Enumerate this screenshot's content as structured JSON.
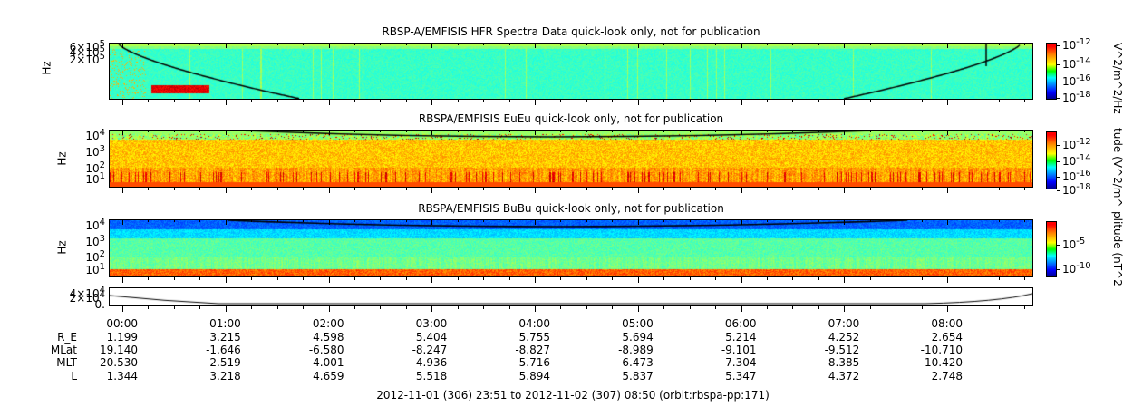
{
  "chart_data": {
    "type": "heatmap",
    "x_range": [
      "2012-11-01 23:51",
      "2012-11-02 08:50"
    ],
    "x_tick_labels": [
      "00:00",
      "01:00",
      "02:00",
      "03:00",
      "04:00",
      "05:00",
      "06:00",
      "07:00",
      "08:00"
    ],
    "panels": [
      {
        "title": "RBSP-A/EMFISIS  HFR Spectra Data quick-look only, not for publication",
        "ylabel": "Hz",
        "yticks": [
          {
            "base": "6×10",
            "exp": "5"
          },
          {
            "base": "4×10",
            "exp": "5"
          },
          {
            "base": "2×10",
            "exp": "5"
          }
        ],
        "colorbar_label": "V^2/m^2/Hz",
        "colorbar_ticks": [
          {
            "base": "10",
            "exp": "-12"
          },
          {
            "base": "10",
            "exp": "-14"
          },
          {
            "base": "10",
            "exp": "-16"
          },
          {
            "base": "10",
            "exp": "-18"
          }
        ]
      },
      {
        "title": "RBSPA/EMFISIS  EuEu quick-look only, not for publication",
        "ylabel": "Hz",
        "yticks": [
          {
            "base": "10",
            "exp": "4"
          },
          {
            "base": "10",
            "exp": "3"
          },
          {
            "base": "10",
            "exp": "2"
          },
          {
            "base": "10",
            "exp": "1"
          }
        ],
        "colorbar_label": "tude (V^2/m^",
        "colorbar_ticks": [
          {
            "base": "10",
            "exp": "-12"
          },
          {
            "base": "10",
            "exp": "-14"
          },
          {
            "base": "10",
            "exp": "-16"
          },
          {
            "base": "10",
            "exp": "-18"
          }
        ]
      },
      {
        "title": "RBSPA/EMFISIS  BuBu quick-look only, not for publication",
        "ylabel": "Hz",
        "yticks": [
          {
            "base": "10",
            "exp": "4"
          },
          {
            "base": "10",
            "exp": "3"
          },
          {
            "base": "10",
            "exp": "2"
          },
          {
            "base": "10",
            "exp": "1"
          }
        ],
        "colorbar_label": "plitude (nT^2",
        "colorbar_ticks": [
          {
            "base": "10",
            "exp": "-5"
          },
          {
            "base": "10",
            "exp": "-10"
          }
        ]
      },
      {
        "title": "",
        "yticks": [
          {
            "base": "4×10",
            "exp": "4"
          },
          {
            "base": "2×10",
            "exp": "4"
          },
          {
            "base": "0.",
            "exp": ""
          }
        ]
      }
    ]
  },
  "ephemeris": {
    "row_labels": [
      "R_E",
      "MLat",
      "MLT",
      "L"
    ],
    "columns": [
      {
        "time": "00:00",
        "RE": "1.199",
        "MLat": "19.140",
        "MLT": "20.530",
        "L": "1.344"
      },
      {
        "time": "01:00",
        "RE": "3.215",
        "MLat": "-1.646",
        "MLT": "2.519",
        "L": "3.218"
      },
      {
        "time": "02:00",
        "RE": "4.598",
        "MLat": "-6.580",
        "MLT": "4.001",
        "L": "4.659"
      },
      {
        "time": "03:00",
        "RE": "5.404",
        "MLat": "-8.247",
        "MLT": "4.936",
        "L": "5.518"
      },
      {
        "time": "04:00",
        "RE": "5.755",
        "MLat": "-8.827",
        "MLT": "5.716",
        "L": "5.894"
      },
      {
        "time": "05:00",
        "RE": "5.694",
        "MLat": "-8.989",
        "MLT": "6.473",
        "L": "5.837"
      },
      {
        "time": "06:00",
        "RE": "5.214",
        "MLat": "-9.101",
        "MLT": "7.304",
        "L": "5.347"
      },
      {
        "time": "07:00",
        "RE": "4.252",
        "MLat": "-9.512",
        "MLT": "8.385",
        "L": "4.372"
      },
      {
        "time": "08:00",
        "RE": "2.654",
        "MLat": "-10.710",
        "MLT": "10.420",
        "L": "2.748"
      }
    ]
  },
  "footer": "2012-11-01 (306) 23:51 to 2012-11-02 (307) 08:50 (orbit:rbspa-pp:171)"
}
